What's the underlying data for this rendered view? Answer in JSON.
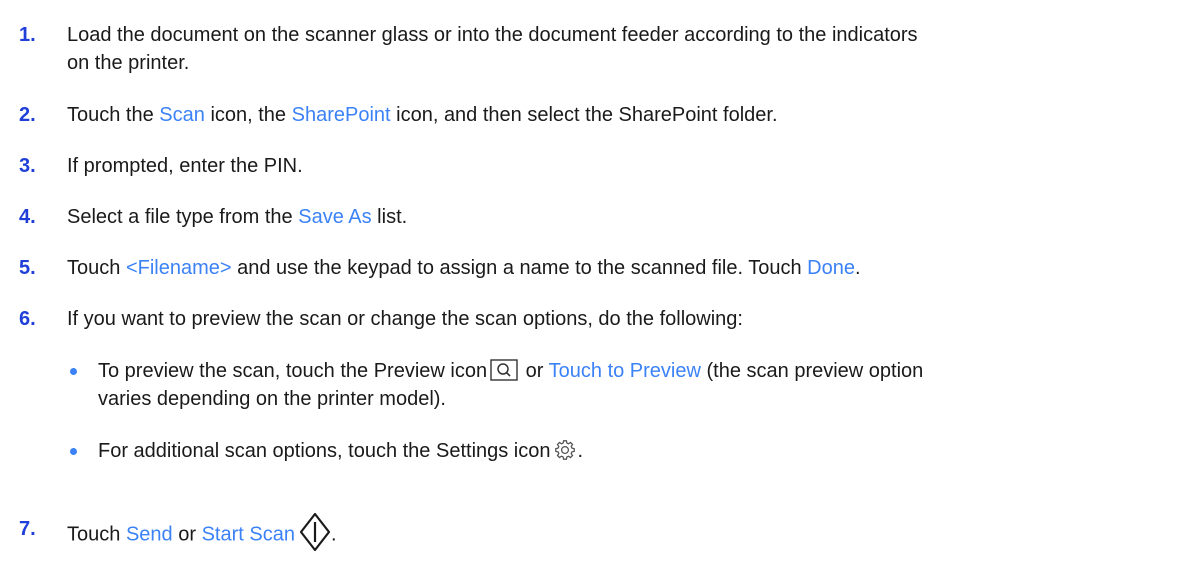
{
  "steps": [
    {
      "number": "1.",
      "line1": "Load the document on the scanner glass or into the document feeder according to the indicators",
      "line2": "on the printer."
    },
    {
      "number": "2.",
      "t1": "Touch the ",
      "scan": "Scan",
      "t2": " icon, the ",
      "sharepoint": "SharePoint",
      "t3": " icon, and then select the SharePoint folder."
    },
    {
      "number": "3.",
      "text": "If prompted, enter the PIN."
    },
    {
      "number": "4.",
      "t1": "Select a file type from the ",
      "save_as": "Save As",
      "t2": " list."
    },
    {
      "number": "5.",
      "t1": "Touch ",
      "filename": "<Filename>",
      "t2": " and use the keypad to assign a name to the scanned file. Touch ",
      "done": "Done",
      "t3": "."
    },
    {
      "number": "6.",
      "text": "If you want to preview the scan or change the scan options, do the following:",
      "bullets": [
        {
          "t1": "To preview the scan, touch the Preview icon",
          "t2": " or ",
          "touch_preview": "Touch to Preview",
          "t3": " (the scan preview option",
          "line2": "varies depending on the printer model)."
        },
        {
          "t1": "For additional scan options, touch the Settings icon",
          "t2": "."
        }
      ]
    },
    {
      "number": "7.",
      "t1": "Touch ",
      "send": "Send",
      "t2": " or ",
      "start_scan": "Start Scan",
      "t3": "."
    }
  ],
  "colors": {
    "step_number": "#1f3fd8",
    "link": "#3b82f6",
    "text": "#1a1a1a"
  },
  "icons": [
    "preview-icon",
    "settings-gear-icon",
    "start-scan-icon"
  ]
}
